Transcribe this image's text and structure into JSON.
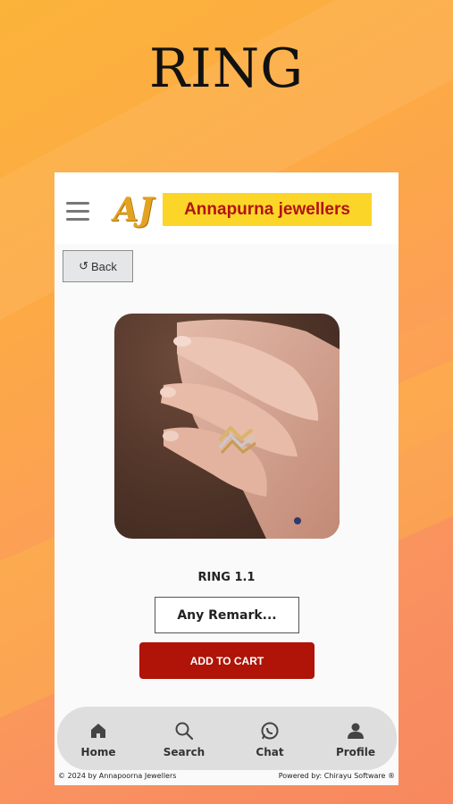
{
  "page_title": "RING",
  "header": {
    "logo_mark": "AJ",
    "logo_text": "Annapurna jewellers"
  },
  "back_button": {
    "label": "Back"
  },
  "product": {
    "name": "RING 1.1",
    "remark_placeholder": "Any Remark...",
    "add_to_cart_label": "ADD TO CART"
  },
  "bottom_nav": {
    "items": [
      {
        "label": "Home",
        "icon": "home-icon"
      },
      {
        "label": "Search",
        "icon": "search-icon"
      },
      {
        "label": "Chat",
        "icon": "whatsapp-icon"
      },
      {
        "label": "Profile",
        "icon": "profile-icon"
      }
    ]
  },
  "footer": {
    "copyright": "© 2024 by Annapoorna Jewellers",
    "powered_by": "Powered by: Chirayu Software ®"
  },
  "colors": {
    "logo_bg": "#fbd629",
    "logo_text": "#b31313",
    "cart_button": "#b01307"
  }
}
